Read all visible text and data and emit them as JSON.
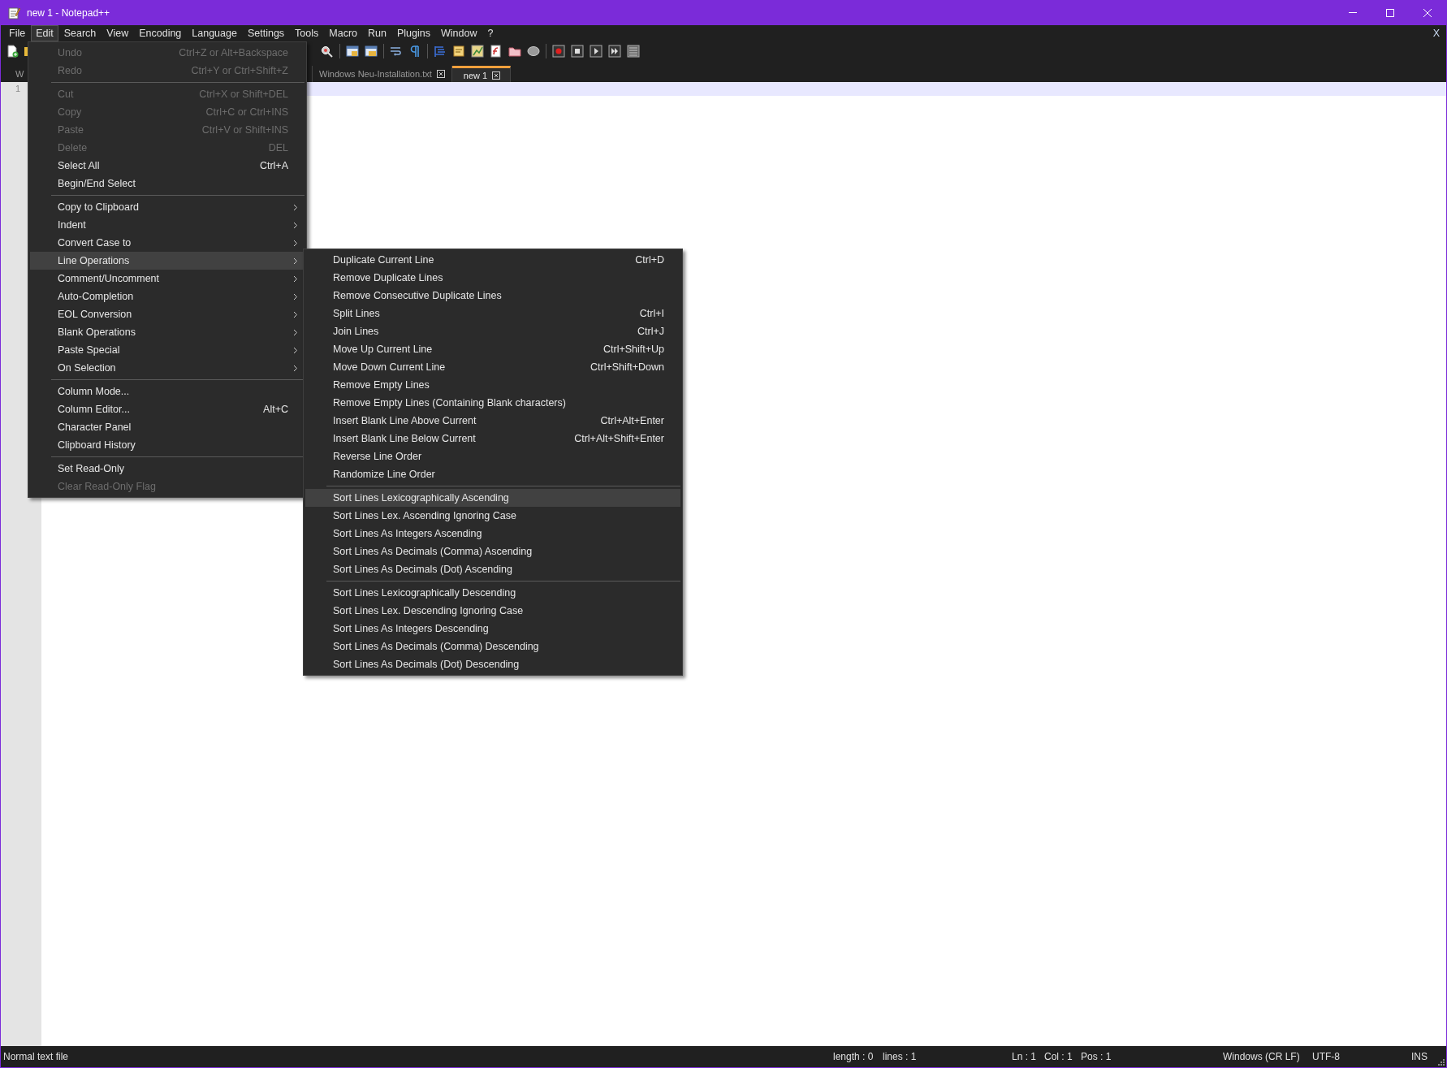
{
  "window": {
    "title": "new 1 - Notepad++"
  },
  "menu_bar": [
    {
      "label": "File",
      "selected": false
    },
    {
      "label": "Edit",
      "selected": true
    },
    {
      "label": "Search",
      "selected": false
    },
    {
      "label": "View",
      "selected": false
    },
    {
      "label": "Encoding",
      "selected": false
    },
    {
      "label": "Language",
      "selected": false
    },
    {
      "label": "Settings",
      "selected": false
    },
    {
      "label": "Tools",
      "selected": false
    },
    {
      "label": "Macro",
      "selected": false
    },
    {
      "label": "Run",
      "selected": false
    },
    {
      "label": "Plugins",
      "selected": false
    },
    {
      "label": "Window",
      "selected": false
    },
    {
      "label": "?",
      "selected": false
    }
  ],
  "close_document": "X",
  "tabs": [
    {
      "label": "W",
      "selected": false
    },
    {
      "label": "Windows Neu-Installation.txt",
      "selected": false
    },
    {
      "label": "new 1",
      "selected": true
    }
  ],
  "editor": {
    "line_numbers": [
      "1"
    ]
  },
  "edit_menu": {
    "items": [
      {
        "kind": "item",
        "label": "Undo",
        "shortcut": "Ctrl+Z or Alt+Backspace",
        "disabled": true,
        "submenu": false,
        "selected": false
      },
      {
        "kind": "item",
        "label": "Redo",
        "shortcut": "Ctrl+Y or Ctrl+Shift+Z",
        "disabled": true,
        "submenu": false,
        "selected": false
      },
      {
        "kind": "separator"
      },
      {
        "kind": "item",
        "label": "Cut",
        "shortcut": "Ctrl+X or Shift+DEL",
        "disabled": true,
        "submenu": false,
        "selected": false
      },
      {
        "kind": "item",
        "label": "Copy",
        "shortcut": "Ctrl+C or Ctrl+INS",
        "disabled": true,
        "submenu": false,
        "selected": false
      },
      {
        "kind": "item",
        "label": "Paste",
        "shortcut": "Ctrl+V or Shift+INS",
        "disabled": true,
        "submenu": false,
        "selected": false
      },
      {
        "kind": "item",
        "label": "Delete",
        "shortcut": "DEL",
        "disabled": true,
        "submenu": false,
        "selected": false
      },
      {
        "kind": "item",
        "label": "Select All",
        "shortcut": "Ctrl+A",
        "disabled": false,
        "submenu": false,
        "selected": false
      },
      {
        "kind": "item",
        "label": "Begin/End Select",
        "disabled": false,
        "submenu": false,
        "selected": false
      },
      {
        "kind": "separator"
      },
      {
        "kind": "item",
        "label": "Copy to Clipboard",
        "disabled": false,
        "submenu": true,
        "selected": false
      },
      {
        "kind": "item",
        "label": "Indent",
        "disabled": false,
        "submenu": true,
        "selected": false
      },
      {
        "kind": "item",
        "label": "Convert Case to",
        "disabled": false,
        "submenu": true,
        "selected": false
      },
      {
        "kind": "item",
        "label": "Line Operations",
        "disabled": false,
        "submenu": true,
        "selected": true
      },
      {
        "kind": "item",
        "label": "Comment/Uncomment",
        "disabled": false,
        "submenu": true,
        "selected": false
      },
      {
        "kind": "item",
        "label": "Auto-Completion",
        "disabled": false,
        "submenu": true,
        "selected": false
      },
      {
        "kind": "item",
        "label": "EOL Conversion",
        "disabled": false,
        "submenu": true,
        "selected": false
      },
      {
        "kind": "item",
        "label": "Blank Operations",
        "disabled": false,
        "submenu": true,
        "selected": false
      },
      {
        "kind": "item",
        "label": "Paste Special",
        "disabled": false,
        "submenu": true,
        "selected": false
      },
      {
        "kind": "item",
        "label": "On Selection",
        "disabled": false,
        "submenu": true,
        "selected": false
      },
      {
        "kind": "separator"
      },
      {
        "kind": "item",
        "label": "Column Mode...",
        "disabled": false,
        "submenu": false,
        "selected": false
      },
      {
        "kind": "item",
        "label": "Column Editor...",
        "shortcut": "Alt+C",
        "disabled": false,
        "submenu": false,
        "selected": false
      },
      {
        "kind": "item",
        "label": "Character Panel",
        "disabled": false,
        "submenu": false,
        "selected": false
      },
      {
        "kind": "item",
        "label": "Clipboard History",
        "disabled": false,
        "submenu": false,
        "selected": false
      },
      {
        "kind": "separator"
      },
      {
        "kind": "item",
        "label": "Set Read-Only",
        "disabled": false,
        "submenu": false,
        "selected": false
      },
      {
        "kind": "item",
        "label": "Clear Read-Only Flag",
        "disabled": true,
        "submenu": false,
        "selected": false
      }
    ]
  },
  "line_operations_menu": {
    "items": [
      {
        "kind": "item",
        "label": "Duplicate Current Line",
        "shortcut": "Ctrl+D",
        "selected": false
      },
      {
        "kind": "item",
        "label": "Remove Duplicate Lines",
        "selected": false
      },
      {
        "kind": "item",
        "label": "Remove Consecutive Duplicate Lines",
        "selected": false
      },
      {
        "kind": "item",
        "label": "Split Lines",
        "shortcut": "Ctrl+I",
        "selected": false
      },
      {
        "kind": "item",
        "label": "Join Lines",
        "shortcut": "Ctrl+J",
        "selected": false
      },
      {
        "kind": "item",
        "label": "Move Up Current Line",
        "shortcut": "Ctrl+Shift+Up",
        "selected": false
      },
      {
        "kind": "item",
        "label": "Move Down Current Line",
        "shortcut": "Ctrl+Shift+Down",
        "selected": false
      },
      {
        "kind": "item",
        "label": "Remove Empty Lines",
        "selected": false
      },
      {
        "kind": "item",
        "label": "Remove Empty Lines (Containing Blank characters)",
        "selected": false
      },
      {
        "kind": "item",
        "label": "Insert Blank Line Above Current",
        "shortcut": "Ctrl+Alt+Enter",
        "selected": false
      },
      {
        "kind": "item",
        "label": "Insert Blank Line Below Current",
        "shortcut": "Ctrl+Alt+Shift+Enter",
        "selected": false
      },
      {
        "kind": "item",
        "label": "Reverse Line Order",
        "selected": false
      },
      {
        "kind": "item",
        "label": "Randomize Line Order",
        "selected": false
      },
      {
        "kind": "separator"
      },
      {
        "kind": "item",
        "label": "Sort Lines Lexicographically Ascending",
        "selected": true
      },
      {
        "kind": "item",
        "label": "Sort Lines Lex. Ascending Ignoring Case",
        "selected": false
      },
      {
        "kind": "item",
        "label": "Sort Lines As Integers Ascending",
        "selected": false
      },
      {
        "kind": "item",
        "label": "Sort Lines As Decimals (Comma) Ascending",
        "selected": false
      },
      {
        "kind": "item",
        "label": "Sort Lines As Decimals (Dot) Ascending",
        "selected": false
      },
      {
        "kind": "separator"
      },
      {
        "kind": "item",
        "label": "Sort Lines Lexicographically Descending",
        "selected": false
      },
      {
        "kind": "item",
        "label": "Sort Lines Lex. Descending Ignoring Case",
        "selected": false
      },
      {
        "kind": "item",
        "label": "Sort Lines As Integers Descending",
        "selected": false
      },
      {
        "kind": "item",
        "label": "Sort Lines As Decimals (Comma) Descending",
        "selected": false
      },
      {
        "kind": "item",
        "label": "Sort Lines As Decimals (Dot) Descending",
        "selected": false
      }
    ]
  },
  "status_bar": {
    "file_type": "Normal text file",
    "length": "length : 0",
    "lines": "lines : 1",
    "ln": "Ln : 1",
    "col": "Col : 1",
    "pos": "Pos : 1",
    "eol": "Windows (CR LF)",
    "encoding": "UTF-8",
    "mode": "INS"
  }
}
